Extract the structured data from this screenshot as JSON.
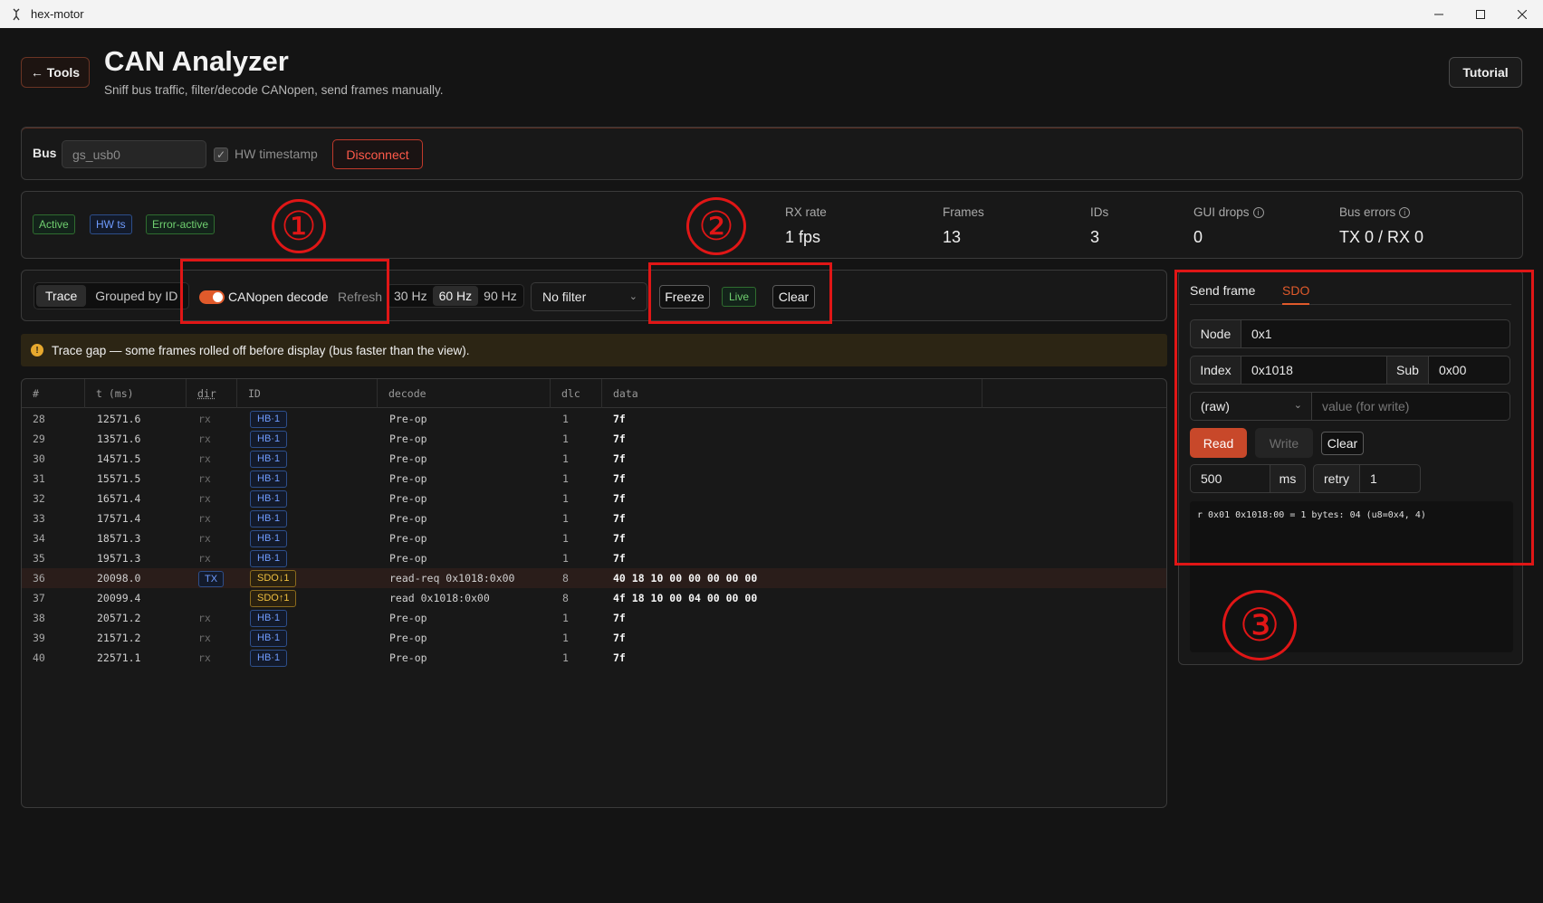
{
  "window": {
    "title": "hex-motor",
    "icon": "app-icon",
    "minimize": "—",
    "maximize": "☐",
    "close": "✕"
  },
  "header": {
    "back_label": "← Tools",
    "title": "CAN Analyzer",
    "subtitle": "Sniff bus traffic, filter/decode CANopen, send frames manually.",
    "tutorial_label": "Tutorial"
  },
  "bus": {
    "label": "Bus",
    "input_value": "gs_usb0",
    "hw_timestamp_label": "HW timestamp",
    "hw_timestamp_checked": true,
    "disconnect_label": "Disconnect"
  },
  "status": {
    "badges": [
      "Active",
      "HW ts",
      "Error-active"
    ],
    "stats": [
      {
        "label": "RX rate",
        "value": "1 fps",
        "info": false
      },
      {
        "label": "Frames",
        "value": "13",
        "info": false
      },
      {
        "label": "IDs",
        "value": "3",
        "info": false
      },
      {
        "label": "GUI drops",
        "value": "0",
        "info": true
      },
      {
        "label": "Bus errors",
        "value": "TX 0 / RX 0",
        "info": true
      }
    ]
  },
  "toolbar": {
    "view_modes": [
      "Trace",
      "Grouped by ID"
    ],
    "active_view": "Trace",
    "canopen_label": "CANopen decode",
    "canopen_enabled": true,
    "refresh_label": "Refresh",
    "refresh_rates": [
      "30 Hz",
      "60 Hz",
      "90 Hz"
    ],
    "active_rate": "60 Hz",
    "filter_value": "No filter",
    "freeze_label": "Freeze",
    "live_label": "Live",
    "clear_label": "Clear"
  },
  "warning": {
    "icon": "!",
    "text": "Trace gap — some frames rolled off before display (bus faster than the view)."
  },
  "trace": {
    "columns": [
      "#",
      "t (ms)",
      "dir",
      "ID",
      "decode",
      "dlc",
      "data"
    ],
    "rows": [
      {
        "num": "28",
        "t": "12571.6",
        "dir": "rx",
        "id": "HB·1",
        "kind": "hb",
        "decode": "Pre-op",
        "dlc": "1",
        "data": "7f"
      },
      {
        "num": "29",
        "t": "13571.6",
        "dir": "rx",
        "id": "HB·1",
        "kind": "hb",
        "decode": "Pre-op",
        "dlc": "1",
        "data": "7f"
      },
      {
        "num": "30",
        "t": "14571.5",
        "dir": "rx",
        "id": "HB·1",
        "kind": "hb",
        "decode": "Pre-op",
        "dlc": "1",
        "data": "7f"
      },
      {
        "num": "31",
        "t": "15571.5",
        "dir": "rx",
        "id": "HB·1",
        "kind": "hb",
        "decode": "Pre-op",
        "dlc": "1",
        "data": "7f"
      },
      {
        "num": "32",
        "t": "16571.4",
        "dir": "rx",
        "id": "HB·1",
        "kind": "hb",
        "decode": "Pre-op",
        "dlc": "1",
        "data": "7f"
      },
      {
        "num": "33",
        "t": "17571.4",
        "dir": "rx",
        "id": "HB·1",
        "kind": "hb",
        "decode": "Pre-op",
        "dlc": "1",
        "data": "7f"
      },
      {
        "num": "34",
        "t": "18571.3",
        "dir": "rx",
        "id": "HB·1",
        "kind": "hb",
        "decode": "Pre-op",
        "dlc": "1",
        "data": "7f"
      },
      {
        "num": "35",
        "t": "19571.3",
        "dir": "rx",
        "id": "HB·1",
        "kind": "hb",
        "decode": "Pre-op",
        "dlc": "1",
        "data": "7f"
      },
      {
        "num": "36",
        "t": "20098.0",
        "dir": "TX",
        "id": "SDO↓1",
        "kind": "sdo",
        "decode": "read-req 0x1018:0x00",
        "dlc": "8",
        "data": "40 18 10 00 00 00 00 00"
      },
      {
        "num": "37",
        "t": "20099.4",
        "dir": "",
        "id": "SDO↑1",
        "kind": "sdo",
        "decode": "read 0x1018:0x00",
        "dlc": "8",
        "data": "4f 18 10 00 04 00 00 00"
      },
      {
        "num": "38",
        "t": "20571.2",
        "dir": "rx",
        "id": "HB·1",
        "kind": "hb",
        "decode": "Pre-op",
        "dlc": "1",
        "data": "7f"
      },
      {
        "num": "39",
        "t": "21571.2",
        "dir": "rx",
        "id": "HB·1",
        "kind": "hb",
        "decode": "Pre-op",
        "dlc": "1",
        "data": "7f"
      },
      {
        "num": "40",
        "t": "22571.1",
        "dir": "rx",
        "id": "HB·1",
        "kind": "hb",
        "decode": "Pre-op",
        "dlc": "1",
        "data": "7f"
      }
    ]
  },
  "sdo_panel": {
    "tabs": [
      "Send frame",
      "SDO"
    ],
    "active_tab": "SDO",
    "node_label": "Node",
    "node_value": "0x1",
    "index_label": "Index",
    "index_value": "0x1018",
    "sub_label": "Sub",
    "sub_value": "0x00",
    "type_value": "(raw)",
    "value_placeholder": "value (for write)",
    "read_label": "Read",
    "write_label": "Write",
    "clear_label": "Clear",
    "timeout_value": "500",
    "timeout_unit": "ms",
    "retry_label": "retry",
    "retry_value": "1",
    "log": "r 0x01  0x1018:00 = 1 bytes: 04  (u8=0x4, 4)"
  },
  "annotations": {
    "one": "①",
    "two": "②",
    "three": "③"
  },
  "colors": {
    "accent": "#e05a2b",
    "annotation": "#e01616",
    "background": "#141414"
  }
}
